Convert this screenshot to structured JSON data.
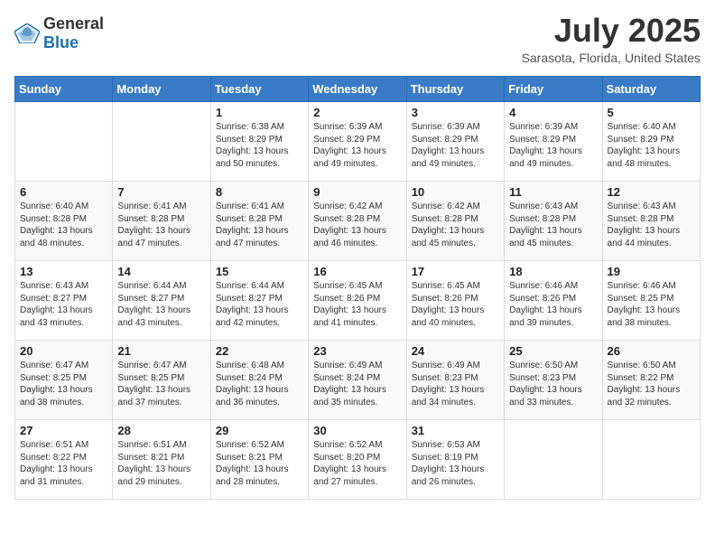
{
  "logo": {
    "general": "General",
    "blue": "Blue"
  },
  "title": {
    "month_year": "July 2025",
    "location": "Sarasota, Florida, United States"
  },
  "weekdays": [
    "Sunday",
    "Monday",
    "Tuesday",
    "Wednesday",
    "Thursday",
    "Friday",
    "Saturday"
  ],
  "weeks": [
    [
      {
        "day": "",
        "info": ""
      },
      {
        "day": "",
        "info": ""
      },
      {
        "day": "1",
        "info": "Sunrise: 6:38 AM\nSunset: 8:29 PM\nDaylight: 13 hours and 50 minutes."
      },
      {
        "day": "2",
        "info": "Sunrise: 6:39 AM\nSunset: 8:29 PM\nDaylight: 13 hours and 49 minutes."
      },
      {
        "day": "3",
        "info": "Sunrise: 6:39 AM\nSunset: 8:29 PM\nDaylight: 13 hours and 49 minutes."
      },
      {
        "day": "4",
        "info": "Sunrise: 6:39 AM\nSunset: 8:29 PM\nDaylight: 13 hours and 49 minutes."
      },
      {
        "day": "5",
        "info": "Sunrise: 6:40 AM\nSunset: 8:29 PM\nDaylight: 13 hours and 48 minutes."
      }
    ],
    [
      {
        "day": "6",
        "info": "Sunrise: 6:40 AM\nSunset: 8:28 PM\nDaylight: 13 hours and 48 minutes."
      },
      {
        "day": "7",
        "info": "Sunrise: 6:41 AM\nSunset: 8:28 PM\nDaylight: 13 hours and 47 minutes."
      },
      {
        "day": "8",
        "info": "Sunrise: 6:41 AM\nSunset: 8:28 PM\nDaylight: 13 hours and 47 minutes."
      },
      {
        "day": "9",
        "info": "Sunrise: 6:42 AM\nSunset: 8:28 PM\nDaylight: 13 hours and 46 minutes."
      },
      {
        "day": "10",
        "info": "Sunrise: 6:42 AM\nSunset: 8:28 PM\nDaylight: 13 hours and 45 minutes."
      },
      {
        "day": "11",
        "info": "Sunrise: 6:43 AM\nSunset: 8:28 PM\nDaylight: 13 hours and 45 minutes."
      },
      {
        "day": "12",
        "info": "Sunrise: 6:43 AM\nSunset: 8:28 PM\nDaylight: 13 hours and 44 minutes."
      }
    ],
    [
      {
        "day": "13",
        "info": "Sunrise: 6:43 AM\nSunset: 8:27 PM\nDaylight: 13 hours and 43 minutes."
      },
      {
        "day": "14",
        "info": "Sunrise: 6:44 AM\nSunset: 8:27 PM\nDaylight: 13 hours and 43 minutes."
      },
      {
        "day": "15",
        "info": "Sunrise: 6:44 AM\nSunset: 8:27 PM\nDaylight: 13 hours and 42 minutes."
      },
      {
        "day": "16",
        "info": "Sunrise: 6:45 AM\nSunset: 8:26 PM\nDaylight: 13 hours and 41 minutes."
      },
      {
        "day": "17",
        "info": "Sunrise: 6:45 AM\nSunset: 8:26 PM\nDaylight: 13 hours and 40 minutes."
      },
      {
        "day": "18",
        "info": "Sunrise: 6:46 AM\nSunset: 8:26 PM\nDaylight: 13 hours and 39 minutes."
      },
      {
        "day": "19",
        "info": "Sunrise: 6:46 AM\nSunset: 8:25 PM\nDaylight: 13 hours and 38 minutes."
      }
    ],
    [
      {
        "day": "20",
        "info": "Sunrise: 6:47 AM\nSunset: 8:25 PM\nDaylight: 13 hours and 38 minutes."
      },
      {
        "day": "21",
        "info": "Sunrise: 6:47 AM\nSunset: 8:25 PM\nDaylight: 13 hours and 37 minutes."
      },
      {
        "day": "22",
        "info": "Sunrise: 6:48 AM\nSunset: 8:24 PM\nDaylight: 13 hours and 36 minutes."
      },
      {
        "day": "23",
        "info": "Sunrise: 6:49 AM\nSunset: 8:24 PM\nDaylight: 13 hours and 35 minutes."
      },
      {
        "day": "24",
        "info": "Sunrise: 6:49 AM\nSunset: 8:23 PM\nDaylight: 13 hours and 34 minutes."
      },
      {
        "day": "25",
        "info": "Sunrise: 6:50 AM\nSunset: 8:23 PM\nDaylight: 13 hours and 33 minutes."
      },
      {
        "day": "26",
        "info": "Sunrise: 6:50 AM\nSunset: 8:22 PM\nDaylight: 13 hours and 32 minutes."
      }
    ],
    [
      {
        "day": "27",
        "info": "Sunrise: 6:51 AM\nSunset: 8:22 PM\nDaylight: 13 hours and 31 minutes."
      },
      {
        "day": "28",
        "info": "Sunrise: 6:51 AM\nSunset: 8:21 PM\nDaylight: 13 hours and 29 minutes."
      },
      {
        "day": "29",
        "info": "Sunrise: 6:52 AM\nSunset: 8:21 PM\nDaylight: 13 hours and 28 minutes."
      },
      {
        "day": "30",
        "info": "Sunrise: 6:52 AM\nSunset: 8:20 PM\nDaylight: 13 hours and 27 minutes."
      },
      {
        "day": "31",
        "info": "Sunrise: 6:53 AM\nSunset: 8:19 PM\nDaylight: 13 hours and 26 minutes."
      },
      {
        "day": "",
        "info": ""
      },
      {
        "day": "",
        "info": ""
      }
    ]
  ]
}
